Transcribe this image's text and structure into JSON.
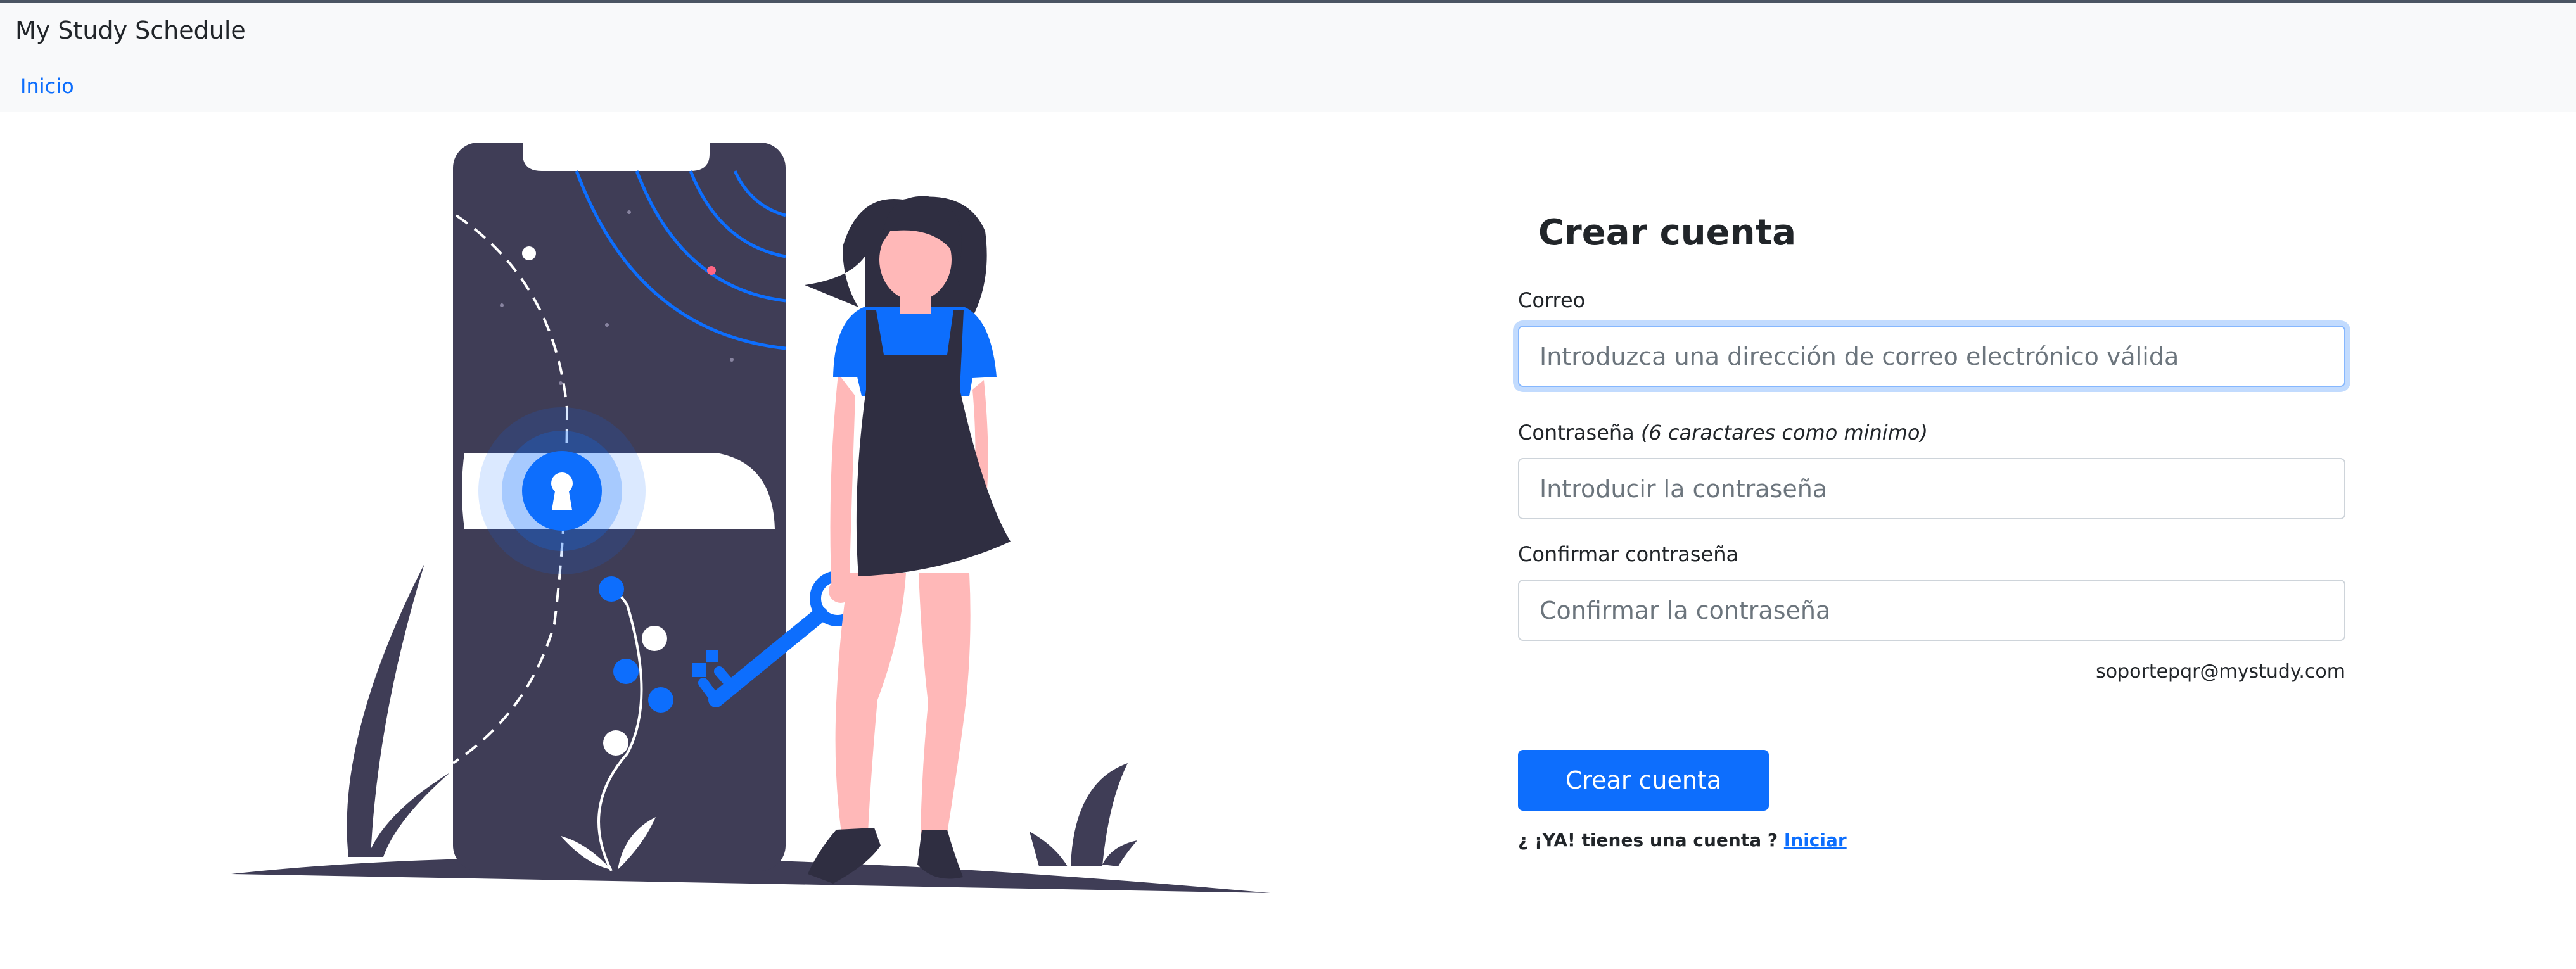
{
  "navbar": {
    "brand": "My Study Schedule",
    "home_link": "Inicio"
  },
  "form": {
    "title": "Crear cuenta",
    "email_label": "Correo",
    "email_placeholder": "Introduzca una dirección de correo electrónico válida",
    "password_label": "Contraseña",
    "password_hint": "(6 caractares como minimo)",
    "password_placeholder": "Introducir la contraseña",
    "confirm_label": "Confirmar contraseña",
    "confirm_placeholder": "Confirmar la contraseña",
    "support_email": "soportepqr@mystudy.com",
    "submit_label": "Crear cuenta",
    "login_prompt": "¿ ¡YA! tienes una cuenta ?",
    "login_link": "Iniciar"
  },
  "colors": {
    "accent": "#0d6efd",
    "dark": "#3f3d56",
    "skin": "#ffb8b8",
    "navbar_bg": "#f8f9fa"
  },
  "illustration": {
    "name": "woman-with-key-illustration"
  }
}
